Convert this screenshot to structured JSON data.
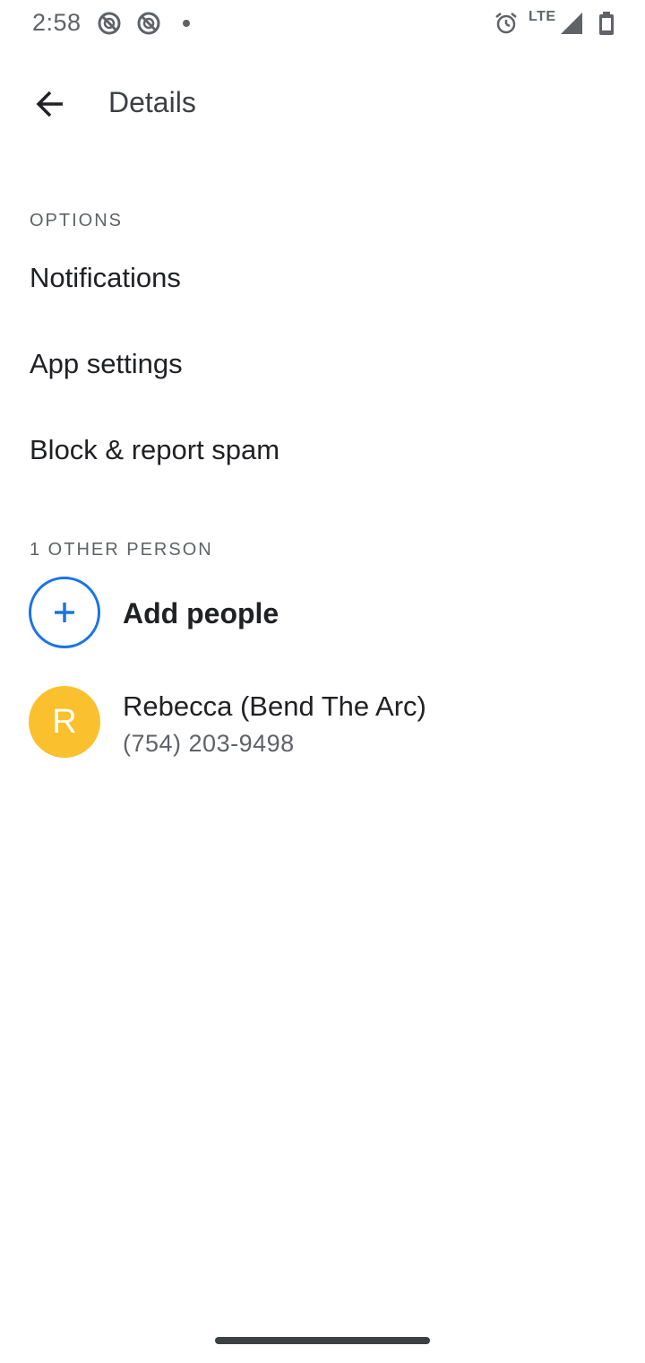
{
  "status_bar": {
    "time": "2:58",
    "network": "LTE",
    "icons": [
      "do-not-disturb-icon",
      "do-not-disturb-icon",
      "notification-dot-icon",
      "alarm-icon",
      "signal-icon",
      "battery-icon"
    ]
  },
  "header": {
    "title": "Details",
    "back_icon": "arrow-back-icon"
  },
  "options": {
    "section_title": "OPTIONS",
    "items": [
      {
        "label": "Notifications"
      },
      {
        "label": "App settings"
      },
      {
        "label": "Block & report spam"
      }
    ]
  },
  "people": {
    "section_title": "1 OTHER PERSON",
    "add_label": "Add people",
    "contacts": [
      {
        "initial": "R",
        "name": "Rebecca (Bend The Arc)",
        "phone": "(754) 203-9498",
        "avatar_color": "#fbc02d"
      }
    ]
  },
  "colors": {
    "accent": "#1a73e8",
    "text_primary": "#202124",
    "text_secondary": "#5f6368"
  }
}
